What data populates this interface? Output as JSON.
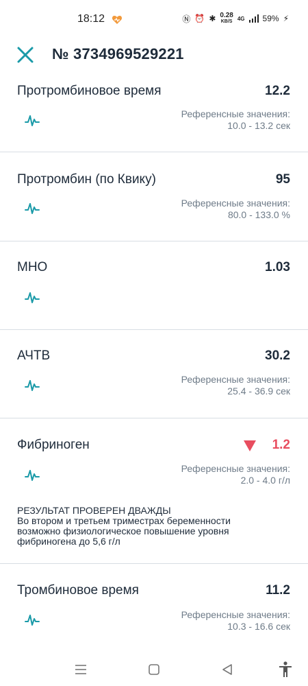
{
  "status_bar": {
    "time": "18:12",
    "speed_value": "0.28",
    "speed_unit": "KB/S",
    "network": "4G",
    "battery": "59%"
  },
  "header": {
    "title": "№ 3734969529221",
    "close_icon": "close-icon"
  },
  "tests": [
    {
      "name": "Протромбиновое время",
      "value": "12.2",
      "ref_label": "Референсные значения:",
      "ref_range": "10.0 - 13.2 сек"
    },
    {
      "name": "Протромбин (по Квику)",
      "value": "95",
      "ref_label": "Референсные значения:",
      "ref_range": "80.0 - 133.0 %"
    },
    {
      "name": "МНО",
      "value": "1.03"
    },
    {
      "name": "АЧТВ",
      "value": "30.2",
      "ref_label": "Референсные значения:",
      "ref_range": "25.4 - 36.9 сек"
    },
    {
      "name": "Фибриноген",
      "value": "1.2",
      "flag": "low",
      "ref_label": "Референсные значения:",
      "ref_range": "2.0 - 4.0 г/л",
      "note_lines": [
        "РЕЗУЛЬТАТ ПРОВЕРЕН ДВАЖДЫ",
        "Во втором и третьем триместрах беременности",
        "возможно физиологическое повышение уровня",
        "фибриногена до 5,6 г/л"
      ]
    },
    {
      "name": "Тромбиновое время",
      "value": "11.2",
      "ref_label": "Референсные значения:",
      "ref_range": "10.3 - 16.6 сек"
    }
  ],
  "colors": {
    "accent": "#1a9aa8",
    "text": "#1e2b3a",
    "muted": "#6e7b88",
    "low": "#e84d5f",
    "divider": "#d7dde3"
  },
  "nav_bar": [
    "menu-icon",
    "home-square-icon",
    "back-triangle-icon",
    "accessibility-icon"
  ]
}
